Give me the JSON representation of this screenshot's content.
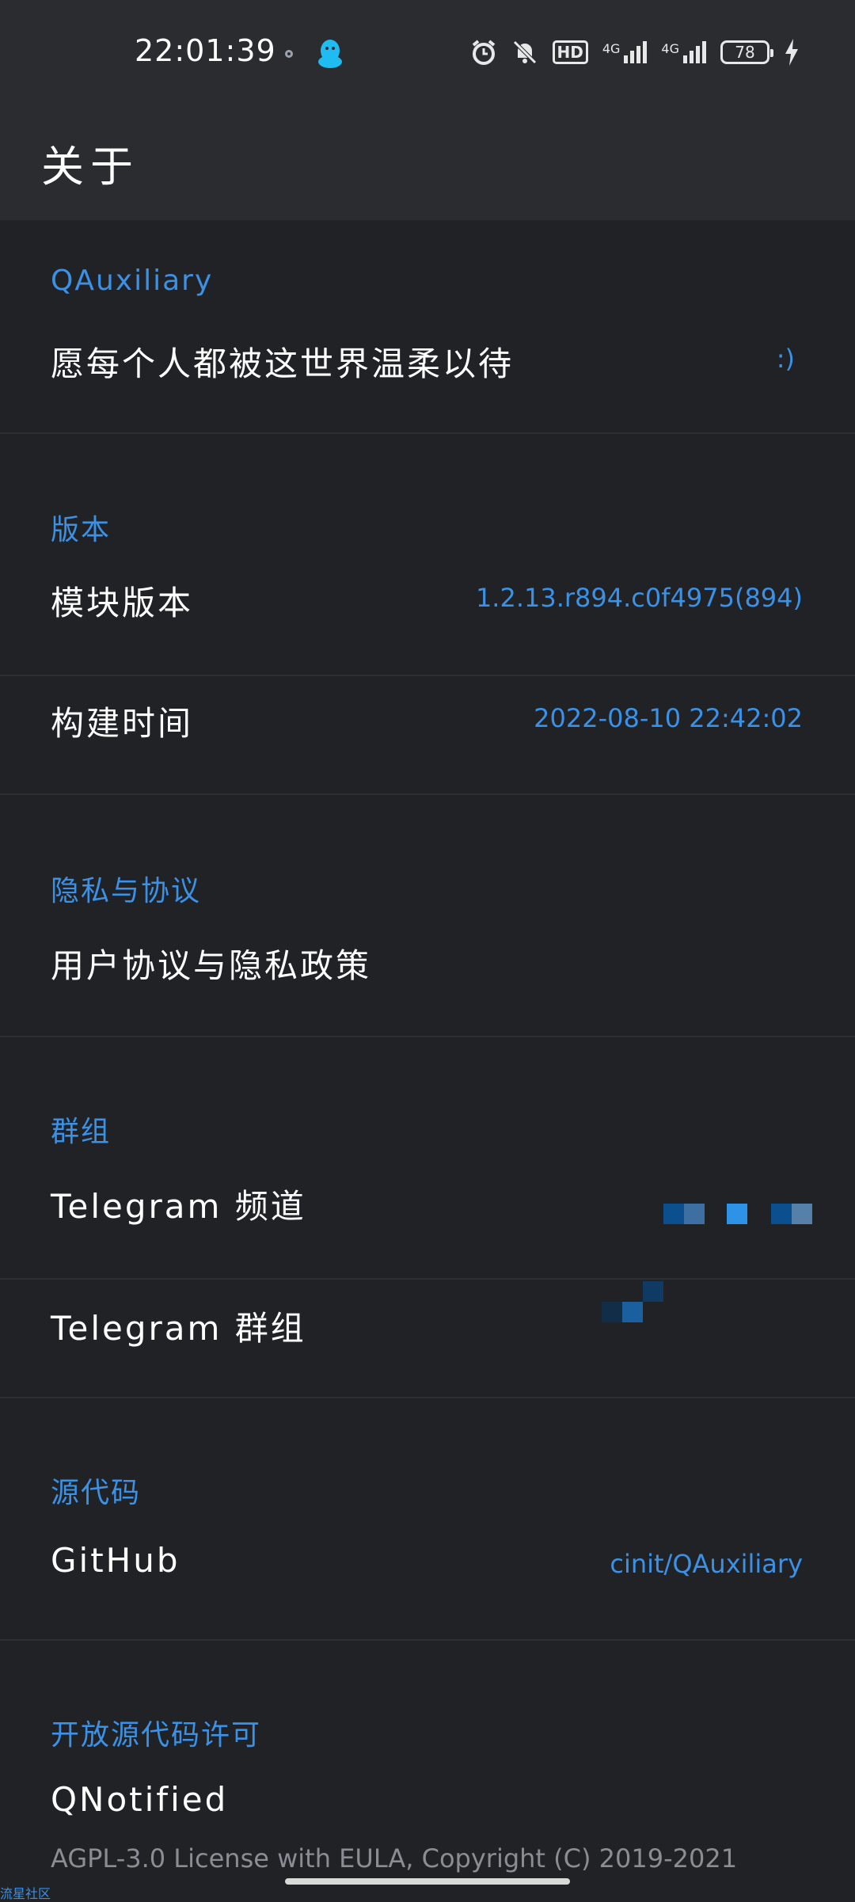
{
  "status_bar": {
    "time": "22:01:39",
    "battery": "78",
    "network_1": "4G",
    "network_2": "4G",
    "hd_badge": "HD"
  },
  "header": {
    "title": "关于"
  },
  "sections": {
    "app": {
      "header": "QAuxiliary",
      "motto": "愿每个人都被这世界温柔以待",
      "motto_value": ":)"
    },
    "version": {
      "header": "版本",
      "module_version_label": "模块版本",
      "module_version_value": "1.2.13.r894.c0f4975(894)",
      "build_time_label": "构建时间",
      "build_time_value": "2022-08-10 22:42:02"
    },
    "privacy": {
      "header": "隐私与协议",
      "policy_label": "用户协议与隐私政策"
    },
    "groups": {
      "header": "群组",
      "telegram_channel_label": "Telegram 频道",
      "telegram_group_label": "Telegram 群组"
    },
    "source": {
      "header": "源代码",
      "github_label": "GitHub",
      "github_value": "cinit/QAuxiliary"
    },
    "licenses": {
      "header": "开放源代码许可",
      "item_title": "QNotified",
      "item_license": "AGPL-3.0 License with EULA, Copyright (C) 2019-2021"
    }
  },
  "corner_tag": "流星社区",
  "colors": {
    "background": "#202226",
    "header_bg": "#2b2c2f",
    "accent": "#3b91e6",
    "divider": "#2e3035"
  }
}
